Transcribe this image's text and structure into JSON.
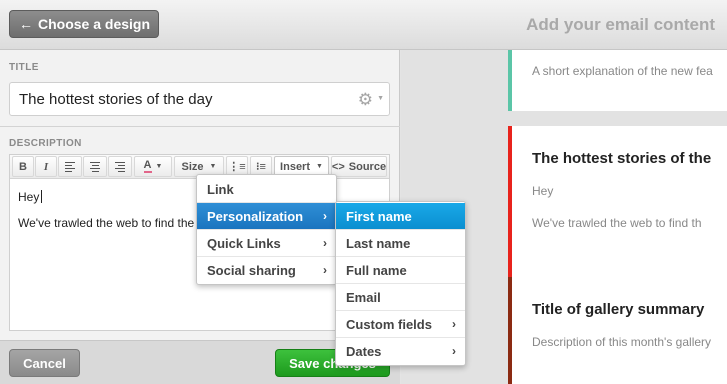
{
  "header": {
    "back_button": "Choose a design",
    "back_icon": "←",
    "page_title": "Add your email content"
  },
  "form": {
    "title_label": "TITLE",
    "title_value": "The hottest stories of the day",
    "gear_icon": "⚙",
    "description_label": "DESCRIPTION"
  },
  "toolbar": {
    "bold": "B",
    "italic": "I",
    "text_color": "A",
    "size": "Size",
    "insert": "Insert",
    "source": "Source",
    "source_icon": "<>"
  },
  "editor": {
    "line1": "Hey",
    "line2": "We've trawled the web to find the"
  },
  "footer": {
    "cancel": "Cancel",
    "save": "Save changes"
  },
  "insert_menu": {
    "items": [
      {
        "label": "Link",
        "has_submenu": false
      },
      {
        "label": "Personalization",
        "has_submenu": true
      },
      {
        "label": "Quick Links",
        "has_submenu": true
      },
      {
        "label": "Social sharing",
        "has_submenu": true
      }
    ]
  },
  "personalization_menu": {
    "items": [
      {
        "label": "First name",
        "has_submenu": false
      },
      {
        "label": "Last name",
        "has_submenu": false
      },
      {
        "label": "Full name",
        "has_submenu": false
      },
      {
        "label": "Email",
        "has_submenu": false
      },
      {
        "label": "Custom fields",
        "has_submenu": true
      },
      {
        "label": "Dates",
        "has_submenu": true
      }
    ]
  },
  "preview": {
    "cards": [
      {
        "title": "",
        "line1": "A short explanation of the new fea",
        "line2": "",
        "accent": "#5bc5a7"
      },
      {
        "title": "The hottest stories of the",
        "line1": "Hey",
        "line2": "We've trawled the web to find th",
        "accent": "#e8231c"
      },
      {
        "title": "Title of gallery summary",
        "line1": "Description of this month's gallery",
        "line2": "",
        "accent": "#8b2a12"
      }
    ]
  },
  "colors": {
    "save_green": "#1f9d1f",
    "menu_active": "#1a74bf",
    "menu_highlight": "#0b8fd0"
  }
}
